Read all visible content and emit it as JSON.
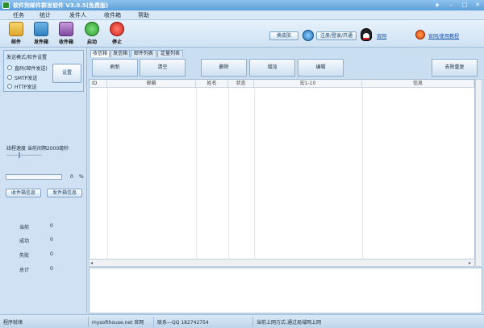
{
  "title": "软件狗邮件群发软件 V3.0.5(免费版)",
  "menu": [
    "任务",
    "统计",
    "发件人",
    "收件箱",
    "帮助"
  ],
  "toolbar": {
    "buttons": [
      {
        "label": "邮件",
        "icon": "envelope-icon"
      },
      {
        "label": "发件箱",
        "icon": "outbox-icon"
      },
      {
        "label": "收件箱",
        "icon": "inbox-icon"
      },
      {
        "label": "启动",
        "icon": "play-icon"
      },
      {
        "label": "停止",
        "icon": "stop-icon"
      }
    ],
    "skin_button": "换皮肤",
    "register_button": "注册/登录/开通",
    "qq_link": "官网",
    "help_link": "官网/使用教程"
  },
  "left": {
    "mode_group_title": "发送模式/软件设置",
    "radios": [
      "直码(邮件发送)",
      "SMTP发送",
      "HTTP发送"
    ],
    "settings_button": "设置",
    "thread_label": "线程速度   当前间隔2000毫秒",
    "progress_value": "0",
    "progress_unit": "%",
    "btn_inbox_info": "收件箱信息",
    "btn_outbox_info": "发件箱信息",
    "stats": [
      {
        "label": "当前",
        "value": "0"
      },
      {
        "label": "成功",
        "value": "0"
      },
      {
        "label": "失败",
        "value": "0"
      },
      {
        "label": "总计",
        "value": "0"
      }
    ]
  },
  "tabs": [
    "收信箱",
    "发信箱",
    "邮件列表",
    "定量列表"
  ],
  "actions": [
    "刷新",
    "清空",
    "删除",
    "增加",
    "编辑",
    "去除重复"
  ],
  "columns": [
    "ID",
    "邮箱",
    "姓名",
    "状态",
    "宏1-10",
    "信息"
  ],
  "status": {
    "left": "程序就绪",
    "site": "mysofthouse.net 官网",
    "contact": "联系—QQ 182742754",
    "right": "当前上网方式:通过局域网上网"
  }
}
